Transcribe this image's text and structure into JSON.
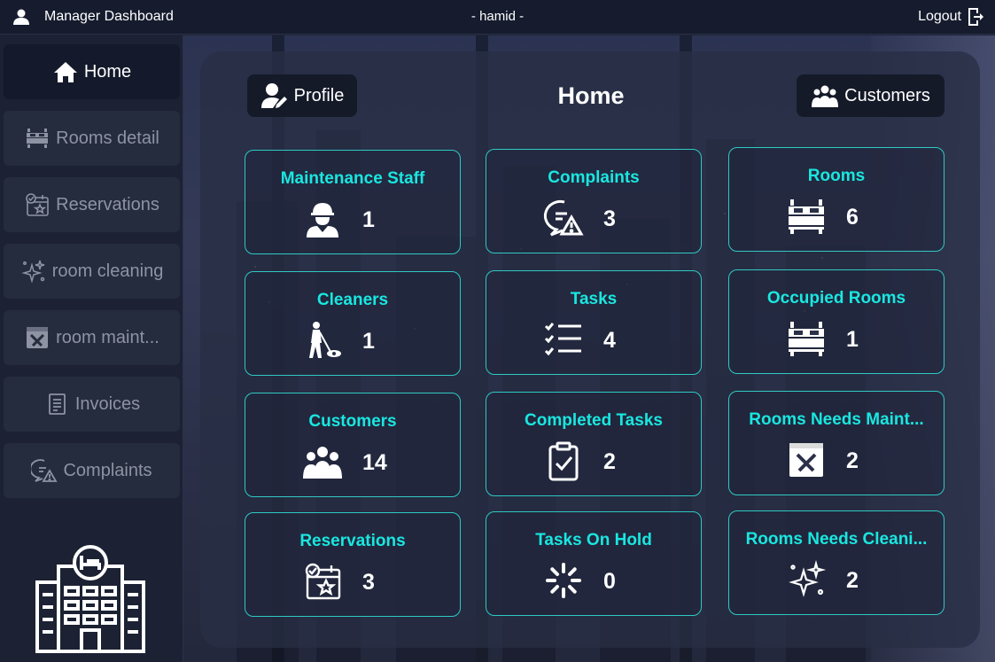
{
  "topbar": {
    "title": "Manager Dashboard",
    "username": "- hamid -",
    "logout": "Logout"
  },
  "sidebar": {
    "items": [
      {
        "label": "Home",
        "icon": "home-icon",
        "active": true
      },
      {
        "label": "Rooms detail",
        "icon": "bed-icon"
      },
      {
        "label": "Reservations",
        "icon": "calendar-icon"
      },
      {
        "label": "room cleaning",
        "icon": "sparkle-icon"
      },
      {
        "label": "room maint...",
        "icon": "tools-window-icon"
      },
      {
        "label": "Invoices",
        "icon": "invoice-icon"
      },
      {
        "label": "Complaints",
        "icon": "complaint-icon"
      }
    ]
  },
  "header": {
    "profile": "Profile",
    "title": "Home",
    "customers": "Customers"
  },
  "cards": [
    {
      "title": "Maintenance Staff",
      "value": "1",
      "icon": "worker-icon"
    },
    {
      "title": "Complaints",
      "value": "3",
      "icon": "complaint-icon"
    },
    {
      "title": "Rooms",
      "value": "6",
      "icon": "bed-icon"
    },
    {
      "title": "Cleaners",
      "value": "1",
      "icon": "cleaner-icon"
    },
    {
      "title": "Tasks",
      "value": "4",
      "icon": "checklist-icon"
    },
    {
      "title": "Occupied Rooms",
      "value": "1",
      "icon": "bed-icon"
    },
    {
      "title": "Customers",
      "value": "14",
      "icon": "group-icon"
    },
    {
      "title": "Completed Tasks",
      "value": "2",
      "icon": "clipboard-check-icon"
    },
    {
      "title": "Rooms Needs Maint...",
      "value": "2",
      "icon": "tools-window-icon"
    },
    {
      "title": "Reservations",
      "value": "3",
      "icon": "calendar-icon"
    },
    {
      "title": "Tasks On Hold",
      "value": "0",
      "icon": "loading-icon"
    },
    {
      "title": "Rooms Needs Cleani...",
      "value": "2",
      "icon": "sparkle-icon"
    }
  ],
  "colors": {
    "accent": "#19e7e0",
    "card_border": "#2fc9c3",
    "topbar": "#161c2e",
    "sidebar": "#1c2233"
  }
}
